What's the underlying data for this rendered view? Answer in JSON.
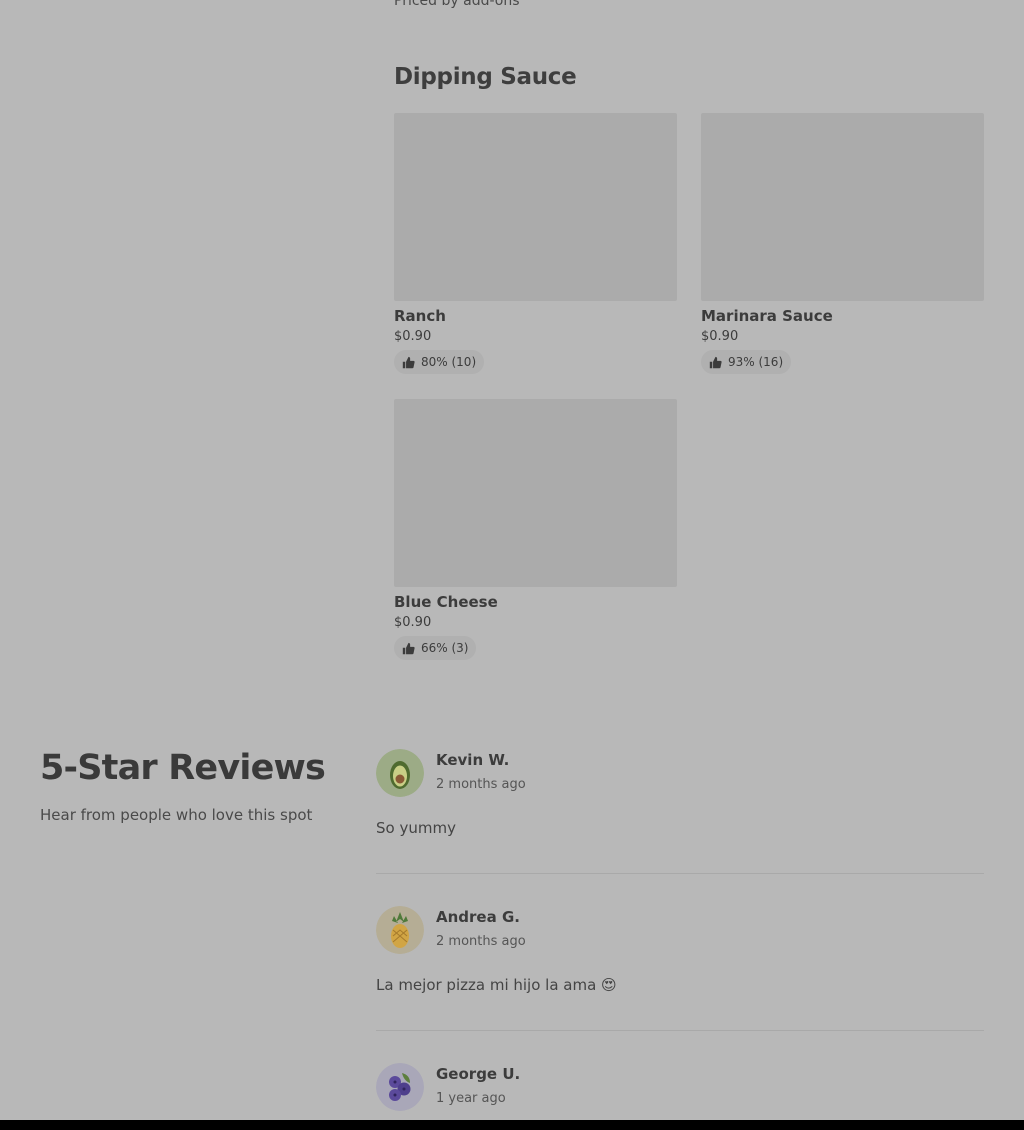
{
  "top_note": "Priced by add-ons",
  "section": {
    "title": "Dipping Sauce",
    "items": [
      {
        "name": "Ranch",
        "price": "$0.90",
        "rating": "80% (10)"
      },
      {
        "name": "Marinara Sauce",
        "price": "$0.90",
        "rating": "93% (16)"
      },
      {
        "name": "Blue Cheese",
        "price": "$0.90",
        "rating": "66% (3)"
      }
    ]
  },
  "reviews": {
    "title": "5-Star Reviews",
    "subtitle": "Hear from people who love this spot",
    "items": [
      {
        "name": "Kevin W.",
        "time": "2 months ago",
        "text": "So yummy",
        "avatar_icon": "avocado-icon"
      },
      {
        "name": "Andrea G.",
        "time": "2 months ago",
        "text": "La mejor pizza mi hijo la ama 😍",
        "avatar_icon": "pineapple-icon"
      },
      {
        "name": "George U.",
        "time": "1 year ago",
        "text": "",
        "avatar_icon": "blueberries-icon"
      }
    ]
  },
  "colors": {
    "overlay_bg": "#b8b8b8",
    "image_placeholder": "#ababab",
    "bottom_bar": "#000000"
  }
}
